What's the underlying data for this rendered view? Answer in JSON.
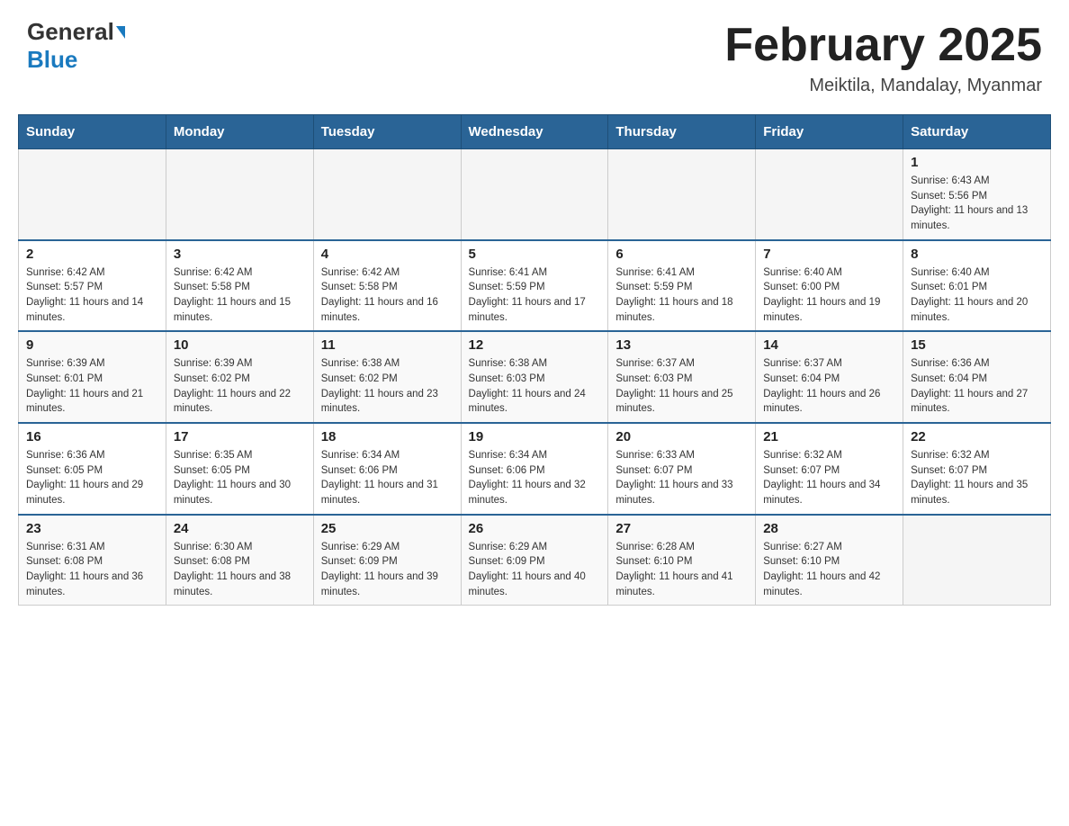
{
  "header": {
    "logo_general": "General",
    "logo_blue": "Blue",
    "month_title": "February 2025",
    "location": "Meiktila, Mandalay, Myanmar"
  },
  "calendar": {
    "days_of_week": [
      "Sunday",
      "Monday",
      "Tuesday",
      "Wednesday",
      "Thursday",
      "Friday",
      "Saturday"
    ],
    "weeks": [
      [
        {
          "day": "",
          "info": ""
        },
        {
          "day": "",
          "info": ""
        },
        {
          "day": "",
          "info": ""
        },
        {
          "day": "",
          "info": ""
        },
        {
          "day": "",
          "info": ""
        },
        {
          "day": "",
          "info": ""
        },
        {
          "day": "1",
          "info": "Sunrise: 6:43 AM\nSunset: 5:56 PM\nDaylight: 11 hours and 13 minutes."
        }
      ],
      [
        {
          "day": "2",
          "info": "Sunrise: 6:42 AM\nSunset: 5:57 PM\nDaylight: 11 hours and 14 minutes."
        },
        {
          "day": "3",
          "info": "Sunrise: 6:42 AM\nSunset: 5:58 PM\nDaylight: 11 hours and 15 minutes."
        },
        {
          "day": "4",
          "info": "Sunrise: 6:42 AM\nSunset: 5:58 PM\nDaylight: 11 hours and 16 minutes."
        },
        {
          "day": "5",
          "info": "Sunrise: 6:41 AM\nSunset: 5:59 PM\nDaylight: 11 hours and 17 minutes."
        },
        {
          "day": "6",
          "info": "Sunrise: 6:41 AM\nSunset: 5:59 PM\nDaylight: 11 hours and 18 minutes."
        },
        {
          "day": "7",
          "info": "Sunrise: 6:40 AM\nSunset: 6:00 PM\nDaylight: 11 hours and 19 minutes."
        },
        {
          "day": "8",
          "info": "Sunrise: 6:40 AM\nSunset: 6:01 PM\nDaylight: 11 hours and 20 minutes."
        }
      ],
      [
        {
          "day": "9",
          "info": "Sunrise: 6:39 AM\nSunset: 6:01 PM\nDaylight: 11 hours and 21 minutes."
        },
        {
          "day": "10",
          "info": "Sunrise: 6:39 AM\nSunset: 6:02 PM\nDaylight: 11 hours and 22 minutes."
        },
        {
          "day": "11",
          "info": "Sunrise: 6:38 AM\nSunset: 6:02 PM\nDaylight: 11 hours and 23 minutes."
        },
        {
          "day": "12",
          "info": "Sunrise: 6:38 AM\nSunset: 6:03 PM\nDaylight: 11 hours and 24 minutes."
        },
        {
          "day": "13",
          "info": "Sunrise: 6:37 AM\nSunset: 6:03 PM\nDaylight: 11 hours and 25 minutes."
        },
        {
          "day": "14",
          "info": "Sunrise: 6:37 AM\nSunset: 6:04 PM\nDaylight: 11 hours and 26 minutes."
        },
        {
          "day": "15",
          "info": "Sunrise: 6:36 AM\nSunset: 6:04 PM\nDaylight: 11 hours and 27 minutes."
        }
      ],
      [
        {
          "day": "16",
          "info": "Sunrise: 6:36 AM\nSunset: 6:05 PM\nDaylight: 11 hours and 29 minutes."
        },
        {
          "day": "17",
          "info": "Sunrise: 6:35 AM\nSunset: 6:05 PM\nDaylight: 11 hours and 30 minutes."
        },
        {
          "day": "18",
          "info": "Sunrise: 6:34 AM\nSunset: 6:06 PM\nDaylight: 11 hours and 31 minutes."
        },
        {
          "day": "19",
          "info": "Sunrise: 6:34 AM\nSunset: 6:06 PM\nDaylight: 11 hours and 32 minutes."
        },
        {
          "day": "20",
          "info": "Sunrise: 6:33 AM\nSunset: 6:07 PM\nDaylight: 11 hours and 33 minutes."
        },
        {
          "day": "21",
          "info": "Sunrise: 6:32 AM\nSunset: 6:07 PM\nDaylight: 11 hours and 34 minutes."
        },
        {
          "day": "22",
          "info": "Sunrise: 6:32 AM\nSunset: 6:07 PM\nDaylight: 11 hours and 35 minutes."
        }
      ],
      [
        {
          "day": "23",
          "info": "Sunrise: 6:31 AM\nSunset: 6:08 PM\nDaylight: 11 hours and 36 minutes."
        },
        {
          "day": "24",
          "info": "Sunrise: 6:30 AM\nSunset: 6:08 PM\nDaylight: 11 hours and 38 minutes."
        },
        {
          "day": "25",
          "info": "Sunrise: 6:29 AM\nSunset: 6:09 PM\nDaylight: 11 hours and 39 minutes."
        },
        {
          "day": "26",
          "info": "Sunrise: 6:29 AM\nSunset: 6:09 PM\nDaylight: 11 hours and 40 minutes."
        },
        {
          "day": "27",
          "info": "Sunrise: 6:28 AM\nSunset: 6:10 PM\nDaylight: 11 hours and 41 minutes."
        },
        {
          "day": "28",
          "info": "Sunrise: 6:27 AM\nSunset: 6:10 PM\nDaylight: 11 hours and 42 minutes."
        },
        {
          "day": "",
          "info": ""
        }
      ]
    ]
  }
}
